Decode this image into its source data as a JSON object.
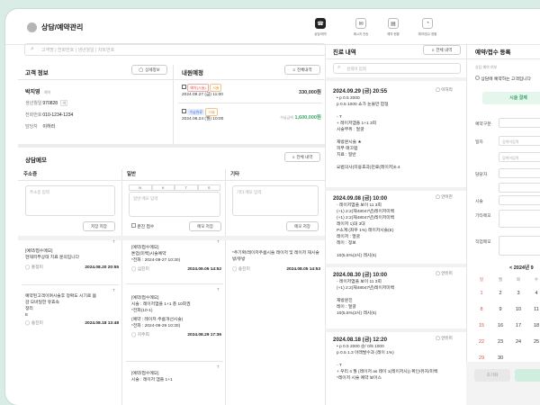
{
  "app": {
    "title": "상담/예약관리"
  },
  "topnav": [
    {
      "label": "상담/예약"
    },
    {
      "label": "메시지 전송"
    },
    {
      "label": "예약 현황"
    },
    {
      "label": "예약/접수 현황"
    }
  ],
  "search": {
    "placeholder": "고객명 | 전화번호 | 생년월일 | 차트번호"
  },
  "customer": {
    "title": "고객 정보",
    "detail_btn": "상세정보",
    "name": "박지영",
    "name_tag": "예약",
    "rows": [
      {
        "k": "생년월일",
        "v": "970828",
        "tag": "여"
      },
      {
        "k": "전화번호",
        "v": "010-1234-1234"
      },
      {
        "k": "담당자",
        "v": "이하리"
      }
    ]
  },
  "history": {
    "title": "내원예정",
    "all_btn": "전체내역",
    "items": [
      {
        "tag1": "예약(시술)",
        "tag2": "시술",
        "date": "2024.09.27 (금) 11:00",
        "amount": "330,000원",
        "amount_prefix": ""
      },
      {
        "tag1": "수납완료",
        "tag2": "시술",
        "date": "2024.06.24 (월) 10:00",
        "amount": "1,600,000원",
        "amount_prefix": "수납금액"
      }
    ]
  },
  "consult": {
    "title": "상담메모",
    "all_btn": "전체 내역",
    "columns": [
      {
        "head": "주소증",
        "placeholder": "주소증 입력",
        "save": "저장 저장"
      },
      {
        "head": "일반",
        "placeholder": "일반 메모 입력",
        "save": "메모 저장",
        "check_label": "문진 접수"
      },
      {
        "head": "기타",
        "placeholder": "기타 메모 입력",
        "save": "메모 저장"
      }
    ],
    "col1_notes": [
      {
        "text": "[예약/접수메모]",
        "text2": "현재피부상태 치료 문의입니다",
        "author": "홍정미",
        "date": "2024.08.20 20:55"
      },
      {
        "text": "예약된고객이며시술후 정확도 시기로 봄",
        "text2": "감 모바일한 유효속",
        "text3": "정리",
        "text4": "E",
        "author": "송진미",
        "date": "2024.08.18 13:48"
      }
    ],
    "col2_notes": [
      {
        "l1": "[예약/접수메모]",
        "l2": "톤업(미백)시술예약",
        "l3": "*전화 : 2024-09-27 10:30)",
        "author": "심진미",
        "date": "2024.09.05 14:52"
      },
      {
        "l1": "[예약/접수메모]",
        "l2": "시술 : 레이저앰플 1+1 총 10회권",
        "l3": "*전화(10-1)",
        "l4": "(예약 : 레이저·주름개선시술)",
        "l5": "*전화 : 2024-09-29 10:30)",
        "author": "지주희",
        "date": "2024.08.29 17:36"
      },
      {
        "l1": "[예약/접수메모]",
        "l2": "시술 : 레이저 앰플 1+1",
        "l3": "",
        "author": "",
        "date": ""
      }
    ],
    "col3_notes": [
      {
        "l1": "*주기확/레이저주름시술 레이저 및 레이저 재시술",
        "l2": "방/유방",
        "author": "송진미",
        "date": "2024.08.05 14:53"
      }
    ]
  },
  "timeline": {
    "title": "진료 내역",
    "all_btn": "전체 내역",
    "search_ph": "검색어 입력",
    "entries": [
      {
        "date": "2024.09.29 (금) 20:55",
        "emp": "이하리",
        "lines": [
          {
            "t": "• p 0.5 2000",
            "c": ""
          },
          {
            "t": "  p 0.5 1000 쇼가 눈물만 합정",
            "c": ""
          },
          {
            "t": "",
            "c": ""
          },
          {
            "t": "- T",
            "c": ""
          },
          {
            "t": "+ 레이저앰플 1+1 3회",
            "c": "o"
          },
          {
            "t": "  시술부위 : 얼굴",
            "c": "o"
          },
          {
            "t": "",
            "c": ""
          },
          {
            "t": "  재방문시술 ★",
            "c": "o"
          },
          {
            "t": "  피부 매끄럽",
            "c": "o"
          },
          {
            "t": "  치료 : 일반",
            "c": "o"
          },
          {
            "t": "",
            "c": ""
          },
          {
            "t": "  요법의사(미용효과)만료(레이저)0.4",
            "c": "o"
          }
        ]
      },
      {
        "date": "2024.09.08 (금) 10:00",
        "emp": "안이진",
        "lines": [
          {
            "t": "- 레이저앰플 보이 11 3회",
            "c": "o"
          },
          {
            "t": "  (+1) 2:2(재48047년)레이저미백",
            "c": "o"
          },
          {
            "t": "  (+1) 2:2(재48047년)레이저미백",
            "c": "o"
          },
          {
            "t": "  레이저 1)대 3대",
            "c": "o"
          },
          {
            "t": "  P소계:(좌우 1%) 레이저시술(E)",
            "c": "o"
          },
          {
            "t": "  레이저 : 얼굴",
            "c": "o"
          },
          {
            "t": "  레이 : 정보",
            "c": "o"
          },
          {
            "t": "",
            "c": ""
          },
          {
            "t": "  10(5.5%(2시) 레시(6)",
            "c": "o"
          }
        ]
      },
      {
        "date": "2024.08.30 (금) 10:00",
        "emp": "안유미",
        "lines": [
          {
            "t": "- 레이저앰플 보이 11 3회",
            "c": "o"
          },
          {
            "t": "  (+1) 2:2(재48047년)레이저미백",
            "c": "o"
          },
          {
            "t": "",
            "c": ""
          },
          {
            "t": "  재방문진",
            "c": "o"
          },
          {
            "t": "  레이 : 얼굴",
            "c": "o"
          },
          {
            "t": "  10(5.5%(2시) 레시(6)",
            "c": "o"
          }
        ]
      },
      {
        "date": "2024.08.18 (금) 12:20",
        "emp": "안유미",
        "lines": [
          {
            "t": "• p 0.5 2000 순/ 0/5 1000",
            "c": ""
          },
          {
            "t": "  p 0.5 1.3 아래발수과 (레이 1%)",
            "c": ""
          },
          {
            "t": "",
            "c": ""
          },
          {
            "t": "- T",
            "c": ""
          },
          {
            "t": "+ 우리 4 월 (레이저 as 레이 1(레이저시)) 확인/유지/미백",
            "c": "o"
          },
          {
            "t": "  *레이저 시술 예약 보이스",
            "c": "o"
          }
        ]
      }
    ]
  },
  "booking": {
    "title": "예약/접수 등록",
    "labels": [
      "예약구분",
      "일자",
      "담당자",
      "예약항목",
      "시술",
      "기타메모",
      "직업메모"
    ],
    "select_label": "상담 예약 여부",
    "check_label": "상담에 예약하는 고객입니다",
    "green_btn": "시술 결제",
    "field_ph": "검색어입력",
    "calendar_month": "< 2024년 9",
    "cal_rows": [
      [
        "1",
        "2",
        "3",
        "4"
      ],
      [
        "8",
        "9",
        "10",
        "11"
      ],
      [
        "15",
        "16",
        "17",
        "18"
      ],
      [
        "22",
        "23",
        "24",
        "25"
      ],
      [
        "29",
        "30",
        "",
        ""
      ]
    ],
    "cal_header": [
      "일",
      "월",
      "화",
      "수"
    ],
    "cancel_btn": "초기화"
  },
  "colors": {
    "orange": "#e07b20",
    "green": "#5cc48e",
    "active_nav": "#222222"
  }
}
